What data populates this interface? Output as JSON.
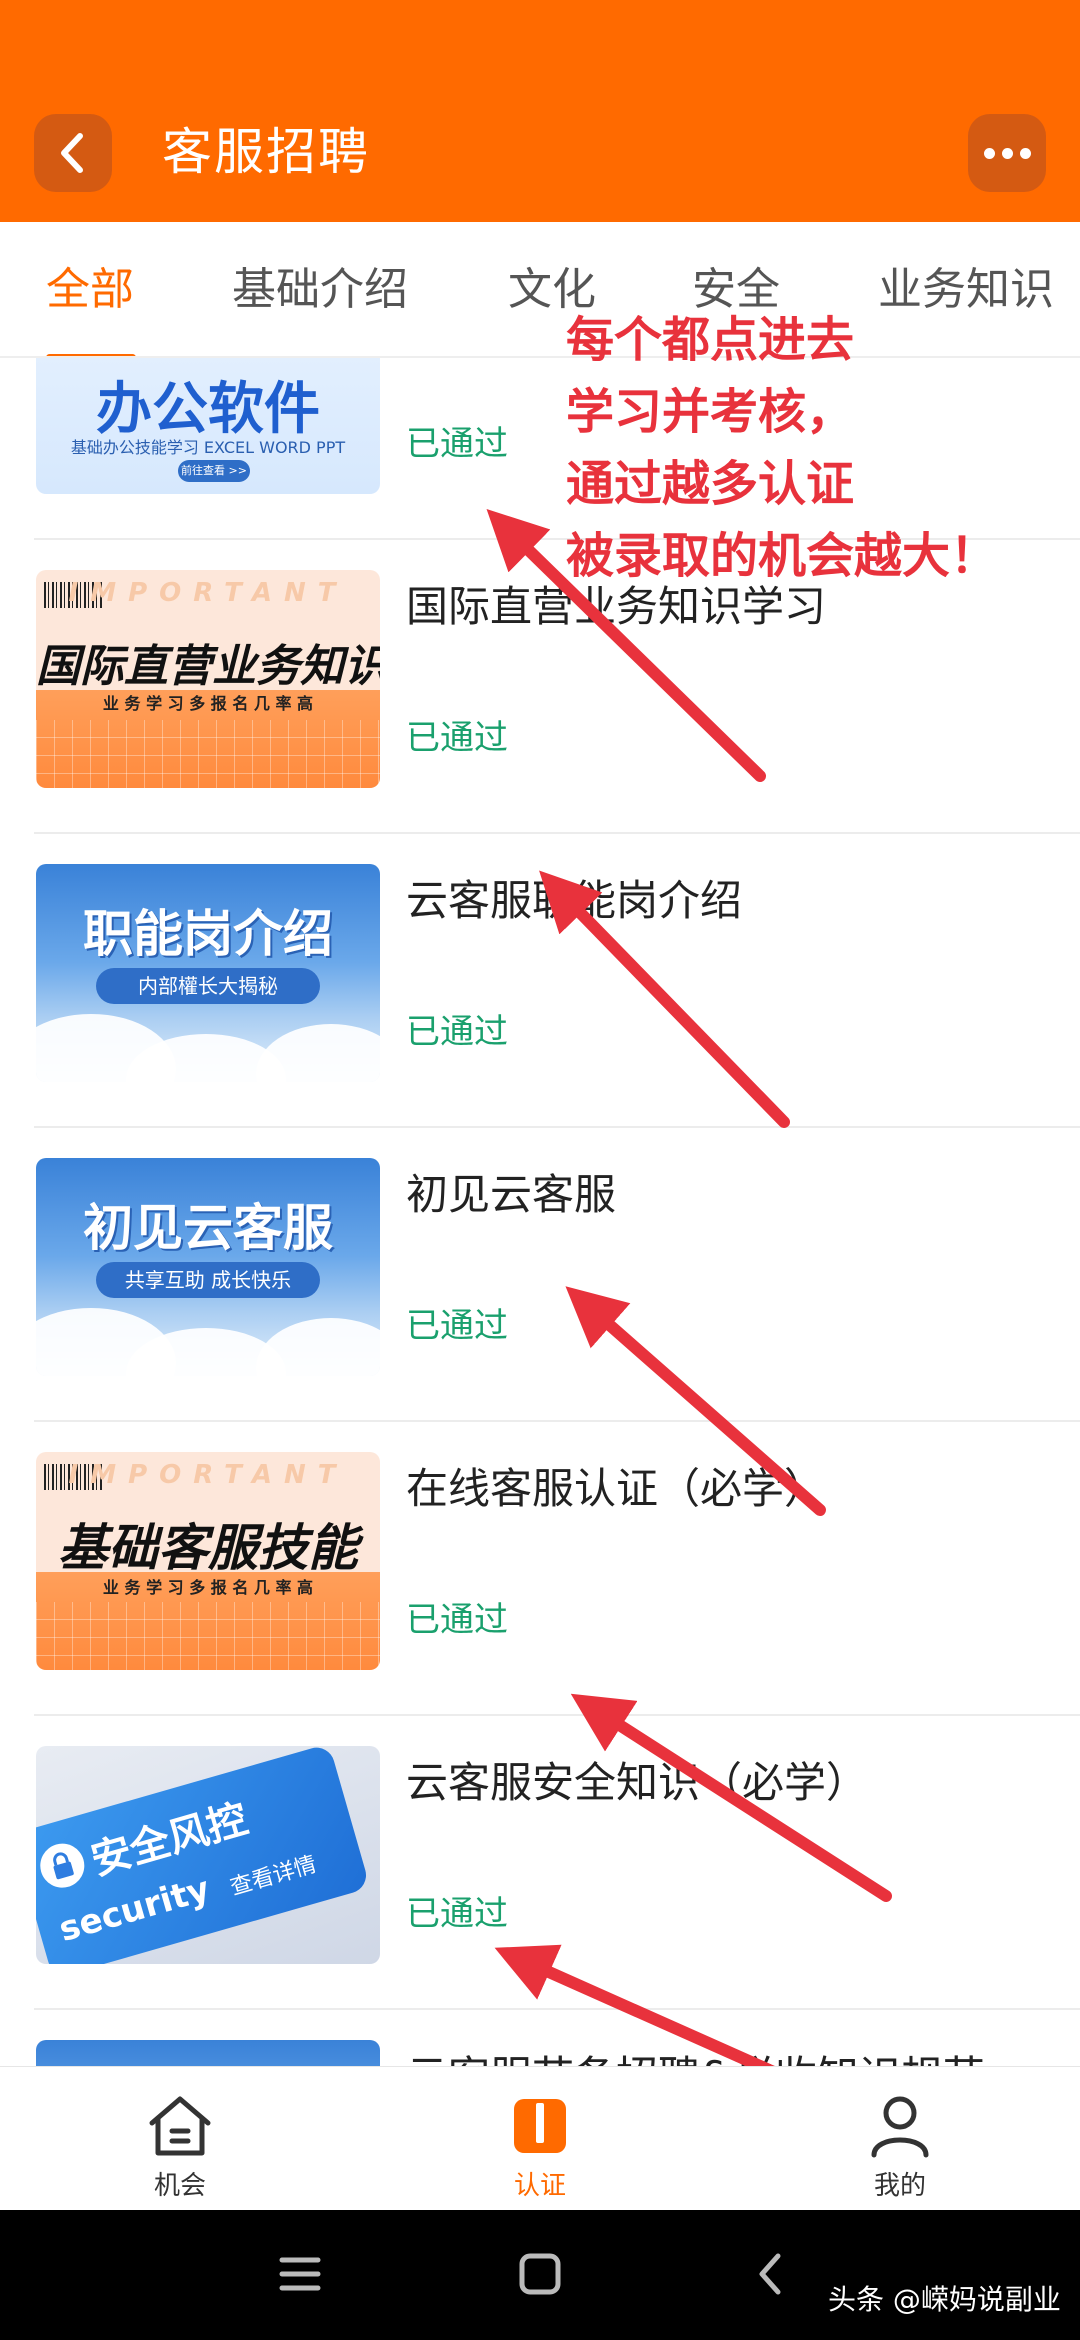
{
  "header": {
    "title": "客服招聘"
  },
  "tabs": [
    {
      "label": "全部",
      "active": true
    },
    {
      "label": "基础介绍"
    },
    {
      "label": "文化"
    },
    {
      "label": "安全"
    },
    {
      "label": "业务知识"
    }
  ],
  "annotation": {
    "lines": [
      "每个都点进去",
      "学习并考核，",
      "通过越多认证",
      "被录取的机会越大！"
    ],
    "color": "#e8323c"
  },
  "items": [
    {
      "title": "",
      "status": "已通过",
      "thumb": {
        "style": "office",
        "headline": "办公软件",
        "sub": "基础办公技能学习 EXCEL WORD PPT",
        "button": "前往查看 >>"
      }
    },
    {
      "title": "国际直营业务知识学习",
      "status": "已通过",
      "thumb": {
        "style": "orange",
        "watermark": "IMPORTANT",
        "headline": "国际直营业务知识",
        "sub": "业 务 学 习 多   报 名 几 率 高"
      }
    },
    {
      "title": "云客服职能岗介绍",
      "status": "已通过",
      "thumb": {
        "style": "sky",
        "headline": "职能岗介绍",
        "sub": "内部權长大揭秘"
      }
    },
    {
      "title": "初见云客服",
      "status": "已通过",
      "thumb": {
        "style": "sky",
        "headline": "初见云客服",
        "sub": "共享互助 成长快乐"
      }
    },
    {
      "title": "在线客服认证（必学）",
      "status": "已通过",
      "thumb": {
        "style": "orange",
        "watermark": "IMPORTANT",
        "headline": "基础客服技能",
        "sub": "业 务 学 习 多   报 名 几 率 高"
      }
    },
    {
      "title": "云客服安全知识（必学）",
      "status": "已通过",
      "thumb": {
        "style": "security",
        "headline": "安全风控",
        "sub": "security",
        "button": "查看详情"
      }
    },
    {
      "title": "云客服节备招聘&税收知识规范",
      "status": "",
      "thumb": {
        "style": "sky",
        "headline": "",
        "sub": ""
      }
    }
  ],
  "bottom_nav": [
    {
      "label": "机会",
      "icon": "home-icon"
    },
    {
      "label": "认证",
      "icon": "certificate-icon",
      "active": true
    },
    {
      "label": "我的",
      "icon": "user-icon"
    }
  ],
  "system_bar": {
    "watermark": "头条 @嵘妈说副业"
  },
  "colors": {
    "brand": "#ff6a00",
    "status_passed": "#1aa06d"
  }
}
